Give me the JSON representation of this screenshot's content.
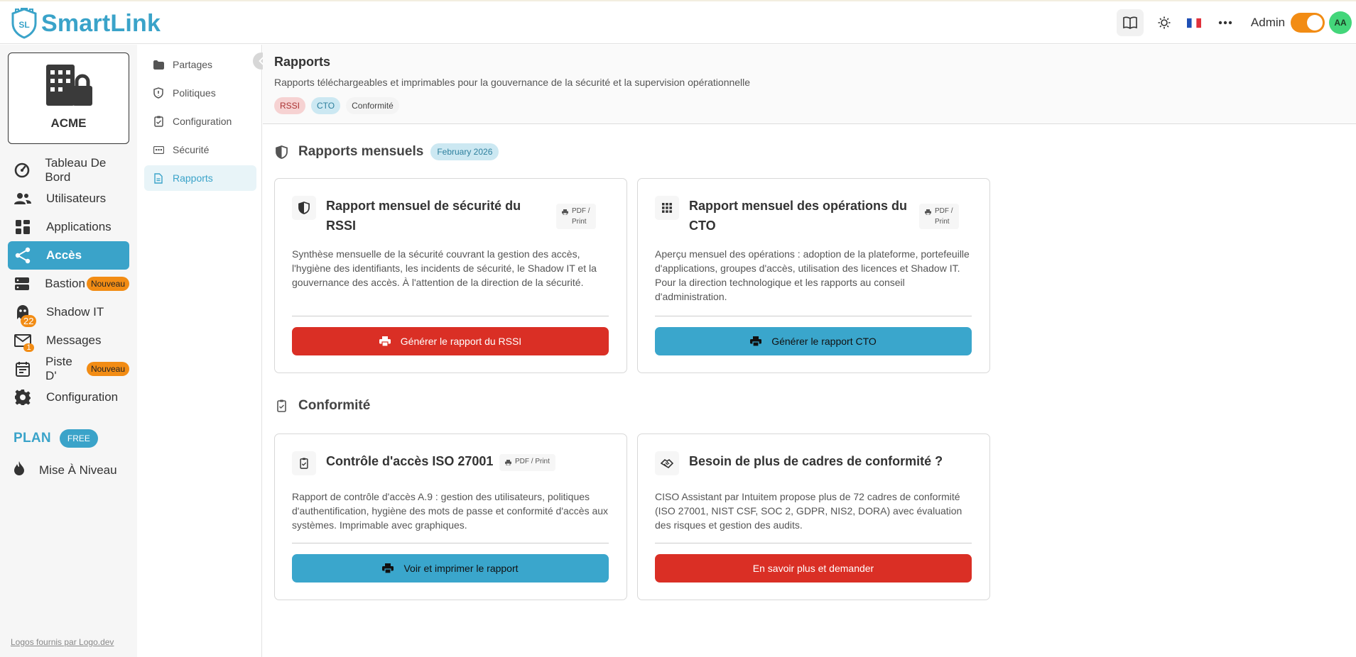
{
  "app": {
    "logo_badge": "SL",
    "name": "SmartLink"
  },
  "topbar": {
    "flag": "🇫🇷",
    "user_label": "Admin",
    "avatar_initials": "AA"
  },
  "org": {
    "name": "ACME"
  },
  "nav": {
    "items": [
      {
        "label": "Tableau De Bord",
        "icon": "gauge-icon"
      },
      {
        "label": "Utilisateurs",
        "icon": "users-icon"
      },
      {
        "label": "Applications",
        "icon": "grid-icon"
      },
      {
        "label": "Accès",
        "icon": "share-icon",
        "active": true
      },
      {
        "label": "Bastion",
        "icon": "server-icon",
        "badge": "Nouveau"
      },
      {
        "label": "Shadow IT",
        "icon": "ghost-icon",
        "count": "22"
      },
      {
        "label": "Messages",
        "icon": "mail-icon",
        "count": "1"
      },
      {
        "label": "Piste D'",
        "icon": "calendar-icon",
        "badge": "Nouveau"
      },
      {
        "label": "Configuration",
        "icon": "gear-icon"
      }
    ],
    "plan_label": "PLAN",
    "plan_value": "FREE",
    "upgrade_label": "Mise À Niveau",
    "credit": "Logos fournis par Logo.dev"
  },
  "subnav": {
    "items": [
      {
        "label": "Partages",
        "icon": "folder-icon"
      },
      {
        "label": "Politiques",
        "icon": "shield-icon"
      },
      {
        "label": "Configuration",
        "icon": "clipboard-icon"
      },
      {
        "label": "Sécurité",
        "icon": "id-card-icon"
      },
      {
        "label": "Rapports",
        "icon": "document-icon",
        "active": true
      }
    ]
  },
  "page": {
    "title": "Rapports",
    "subtitle": "Rapports téléchargeables et imprimables pour la gouvernance de la sécurité et la supervision opérationnelle",
    "tags": [
      "RSSI",
      "CTO",
      "Conformité"
    ]
  },
  "monthly": {
    "title": "Rapports mensuels",
    "date": "February 2026",
    "rssi": {
      "title_line1": "Rapport mensuel de sécurité du",
      "title_line2": "RSSI",
      "format_line1": "PDF /",
      "format_line2": "Print",
      "description": "Synthèse mensuelle de la sécurité couvrant la gestion des accès, l'hygiène des identifiants, les incidents de sécurité, le Shadow IT et la gouvernance des accès. À l'attention de la direction de la sécurité.",
      "button": "Générer le rapport du RSSI"
    },
    "cto": {
      "title_line1": "Rapport mensuel des opérations du",
      "title_line2": "CTO",
      "format_line1": "PDF /",
      "format_line2": "Print",
      "description": "Aperçu mensuel des opérations : adoption de la plateforme, portefeuille d'applications, groupes d'accès, utilisation des licences et Shadow IT. Pour la direction technologique et les rapports au conseil d'administration.",
      "button": "Générer le rapport CTO"
    }
  },
  "compliance": {
    "title": "Conformité",
    "iso": {
      "title": "Contrôle d'accès ISO 27001",
      "format": "PDF / Print",
      "description": "Rapport de contrôle d'accès A.9 : gestion des utilisateurs, politiques d'authentification, hygiène des mots de passe et conformité d'accès aux systèmes. Imprimable avec graphiques.",
      "button": "Voir et imprimer le rapport"
    },
    "more": {
      "title": "Besoin de plus de cadres de conformité ?",
      "description": "CISO Assistant par Intuitem propose plus de 72 cadres de conformité (ISO 27001, NIST CSF, SOC 2, GDPR, NIS2, DORA) avec évaluation des risques et gestion des audits.",
      "button": "En savoir plus et demander"
    }
  }
}
